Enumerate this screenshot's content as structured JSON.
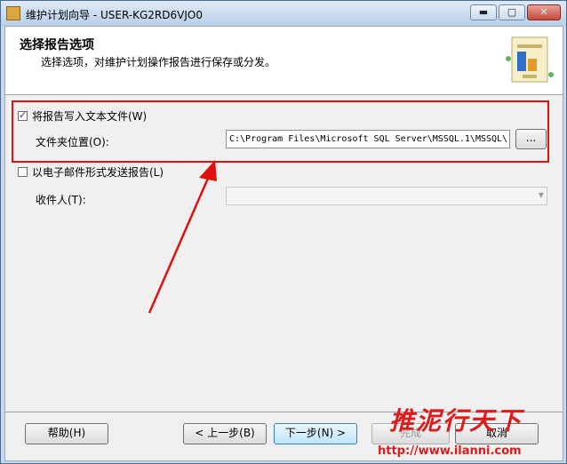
{
  "window": {
    "title": "维护计划向导 - USER-KG2RD6VJO0",
    "caption_buttons": {
      "minimize": "▬",
      "maximize": "▢",
      "close": "✕"
    }
  },
  "header": {
    "title": "选择报告选项",
    "subtitle": "选择选项，对维护计划操作报告进行保存或分发。"
  },
  "options": {
    "write_text_file": {
      "label": "将报告写入文本文件(W)",
      "checked": true
    },
    "folder_label": "文件夹位置(O):",
    "folder_path": "C:\\Program Files\\Microsoft SQL Server\\MSSQL.1\\MSSQL\\",
    "browse_label": "...",
    "email": {
      "label": "以电子邮件形式发送报告(L)",
      "checked": false
    },
    "recipient_label": "收件人(T):",
    "recipient_value": ""
  },
  "buttons": {
    "help": "帮助(H)",
    "back": "< 上一步(B)",
    "next": "下一步(N) >",
    "finish": "完成",
    "cancel": "取消"
  },
  "watermark": {
    "text": "推泥行天下",
    "url": "http://www.ilanni.com"
  },
  "colors": {
    "highlight": "#e01010",
    "watermark": "#e01a1a"
  }
}
